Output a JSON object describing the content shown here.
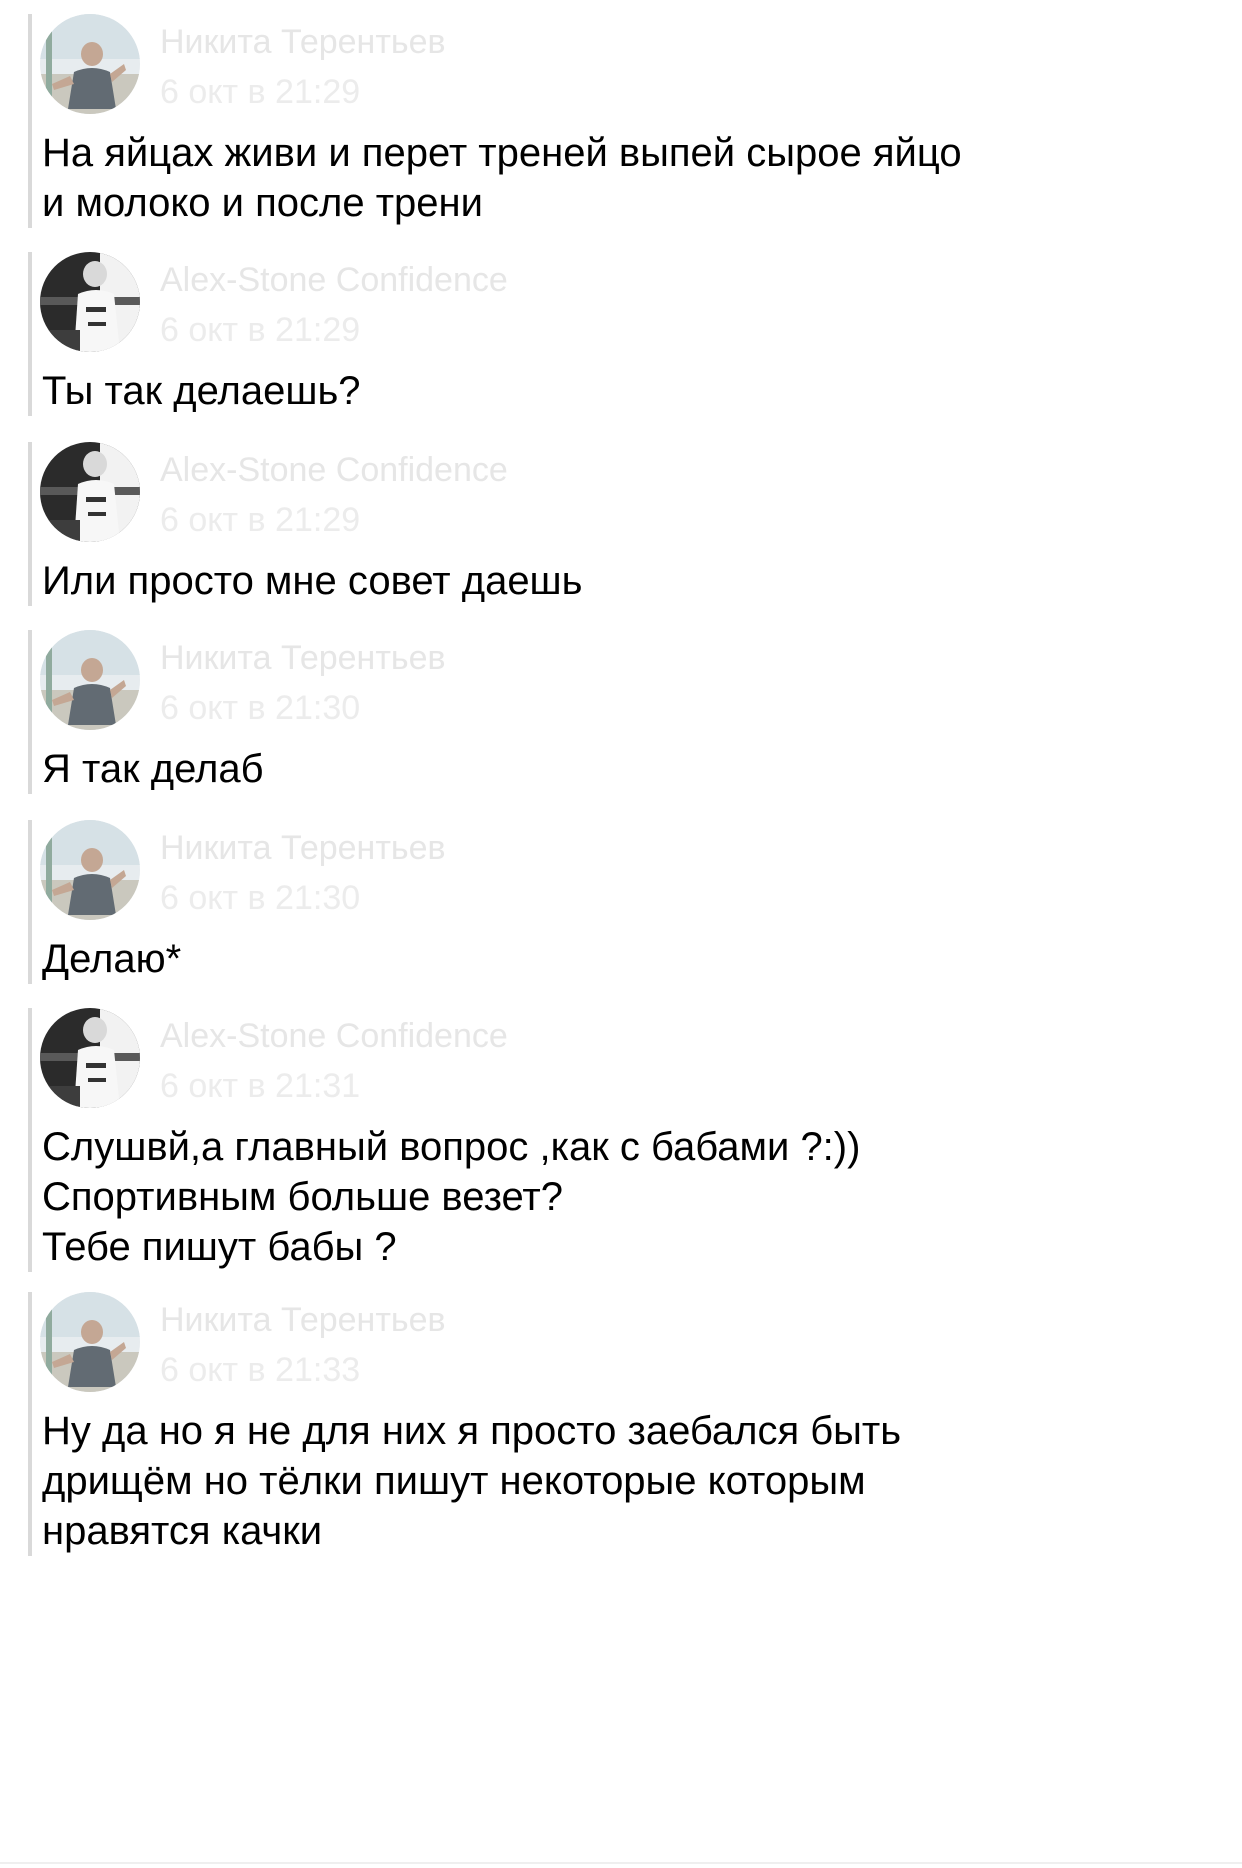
{
  "messages": [
    {
      "author": "Никита Терентьев",
      "time": "6 окт в 21:29",
      "avatar": "avatar-nikita",
      "text": "На яйцах живи и перет треней выпей сырое яйцо\nи молоко и после трени"
    },
    {
      "author": "Alex-Stone Confidence",
      "time": "6 окт в 21:29",
      "avatar": "avatar-alex",
      "text": "Ты так делаешь?"
    },
    {
      "author": "Alex-Stone Confidence",
      "time": "6 окт в 21:29",
      "avatar": "avatar-alex",
      "text": "Или просто мне совет даешь"
    },
    {
      "author": "Никита Терентьев",
      "time": "6 окт в 21:30",
      "avatar": "avatar-nikita",
      "text": "Я так делаб"
    },
    {
      "author": "Никита Терентьев",
      "time": "6 окт в 21:30",
      "avatar": "avatar-nikita",
      "text": "Делаю*"
    },
    {
      "author": "Alex-Stone Confidence",
      "time": "6 окт в 21:31",
      "avatar": "avatar-alex",
      "text": "Слушвй,а главный вопрос ,как с бабами ?:))\nСпортивным больше везет?\nТебе пишут бабы ?"
    },
    {
      "author": "Никита Терентьев",
      "time": "6 окт в 21:33",
      "avatar": "avatar-nikita",
      "text": "Ну да но я не для них я просто заебался быть\nдрищём но тёлки пишут некоторые которым\nнравятся качки"
    }
  ]
}
